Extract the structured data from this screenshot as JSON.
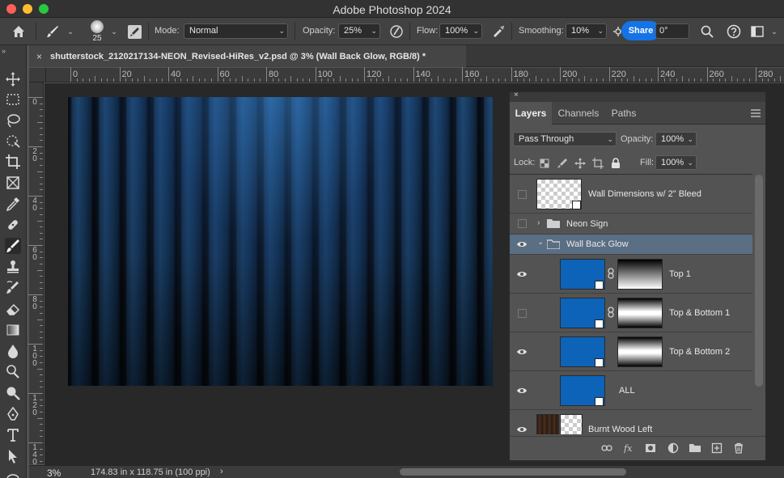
{
  "window": {
    "title": "Adobe Photoshop 2024"
  },
  "options_bar": {
    "brush_size": "25",
    "mode_label": "Mode:",
    "mode_value": "Normal",
    "opacity_label": "Opacity:",
    "opacity_value": "25%",
    "flow_label": "Flow:",
    "flow_value": "100%",
    "smoothing_label": "Smoothing:",
    "smoothing_value": "10%",
    "angle_value": "0°",
    "share_label": "Share"
  },
  "document_tab": {
    "close_glyph": "×",
    "title": "shutterstock_2120217134-NEON_Revised-HiRes_v2.psd @ 3% (Wall Back Glow, RGB/8) *"
  },
  "ruler": {
    "top_labels": [
      "0",
      "20",
      "40",
      "60",
      "80",
      "100",
      "120",
      "140",
      "160",
      "180",
      "200",
      "220",
      "240",
      "260",
      "280"
    ],
    "left_labels": [
      "0",
      "2 0",
      "4 0",
      "6 0",
      "8 0",
      "1 0 0",
      "1 2 0",
      "1 4 0"
    ]
  },
  "status_bar": {
    "zoom": "3%",
    "doc_info": "174.83 in x 118.75 in (100 ppi)",
    "arrow": "›"
  },
  "layers_panel": {
    "close_glyph": "×",
    "tabs": [
      "Layers",
      "Channels",
      "Paths"
    ],
    "active_tab": "Layers",
    "blend_mode": "Pass Through",
    "opacity_label": "Opacity:",
    "opacity_value": "100%",
    "lock_label": "Lock:",
    "fill_label": "Fill:",
    "fill_value": "100%",
    "layers": [
      {
        "name": "Wall Dimensions w/ 2\" Bleed",
        "visible": false,
        "kind": "smart-object"
      },
      {
        "name": "Neon Sign",
        "visible": false,
        "kind": "group-collapsed"
      },
      {
        "name": "Wall Back Glow",
        "visible": true,
        "kind": "group-expanded",
        "selected": true
      },
      {
        "name": "Top 1",
        "visible": true,
        "kind": "masked-fill"
      },
      {
        "name": "Top & Bottom 1",
        "visible": false,
        "kind": "masked-fill"
      },
      {
        "name": "Top & Bottom 2",
        "visible": true,
        "kind": "masked-fill"
      },
      {
        "name": "ALL",
        "visible": true,
        "kind": "fill"
      },
      {
        "name": "Burnt Wood Left",
        "visible": true,
        "kind": "image"
      }
    ]
  },
  "colors": {
    "accent": "#1473e6",
    "selected_row": "#5a6e84",
    "fill_layer": "#0d63b8"
  }
}
